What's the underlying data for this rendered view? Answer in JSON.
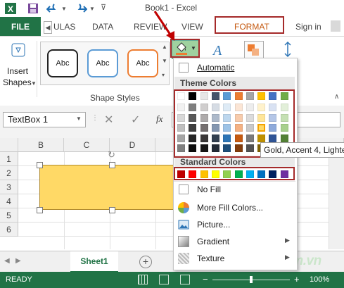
{
  "titlebar": {
    "title": "Book1 - Excel"
  },
  "tabs": {
    "file": "FILE",
    "items": [
      "ULAS",
      "DATA",
      "REVIEW",
      "VIEW"
    ],
    "format": "FORMAT",
    "signin": "Sign in"
  },
  "ribbon": {
    "insert_shapes_line1": "Insert",
    "insert_shapes_line2": "Shapes",
    "abc1": "Abc",
    "abc2": "Abc",
    "abc3": "Abc",
    "shape_styles_label": "Shape Styles"
  },
  "formula_bar": {
    "name_box": "TextBox 1",
    "fx": "fx"
  },
  "sheet": {
    "columns": [
      "B",
      "C",
      "D"
    ],
    "rows": [
      "1",
      "2",
      "3",
      "4",
      "5",
      "6"
    ],
    "tab": "Sheet1"
  },
  "status": {
    "ready": "READY",
    "zoom": "100%"
  },
  "menu": {
    "automatic": "Automatic",
    "theme_header": "Theme Colors",
    "standard_header": "Standard Colors",
    "no_fill": "No Fill",
    "more_colors": "More Fill Colors...",
    "picture": "Picture...",
    "gradient": "Gradient",
    "texture": "Texture"
  },
  "tooltip": "Gold, Accent 4, Lighte",
  "watermark": "ThuThuatPhanMem.vn",
  "colors": {
    "accent": "#217346",
    "highlight": "#a52a2a",
    "shape_fill": "#ffd966",
    "theme_top": [
      "#ffffff",
      "#000000",
      "#e7e6e6",
      "#44546a",
      "#5b9bd5",
      "#ed7d31",
      "#a5a5a5",
      "#ffc000",
      "#4472c4",
      "#70ad47"
    ],
    "theme_shades": [
      [
        "#f2f2f2",
        "#7f7f7f",
        "#d0cece",
        "#d6dce4",
        "#deebf6",
        "#fbe5d5",
        "#ededed",
        "#fff2cc",
        "#d9e2f3",
        "#e2efd9"
      ],
      [
        "#d8d8d8",
        "#595959",
        "#aeabab",
        "#adb9ca",
        "#bdd7ee",
        "#f7cbac",
        "#dbdbdb",
        "#fee599",
        "#b4c6e7",
        "#c5e0b3"
      ],
      [
        "#bfbfbf",
        "#3f3f3f",
        "#757070",
        "#8496b0",
        "#9dc3e6",
        "#f4b183",
        "#c9c9c9",
        "#ffd966",
        "#8eaadb",
        "#a8d08d"
      ],
      [
        "#a5a5a5",
        "#262626",
        "#3a3838",
        "#323f4f",
        "#2e75b5",
        "#c55a11",
        "#7b7b7b",
        "#bf9000",
        "#2f5496",
        "#538135"
      ],
      [
        "#7f7f7f",
        "#0c0c0c",
        "#171616",
        "#222a35",
        "#1e4e79",
        "#833c0b",
        "#525252",
        "#7f6000",
        "#1f3864",
        "#375623"
      ]
    ],
    "standard": [
      "#c00000",
      "#ff0000",
      "#ffc000",
      "#ffff00",
      "#92d050",
      "#00b050",
      "#00b0f0",
      "#0070c0",
      "#002060",
      "#7030a0"
    ]
  }
}
